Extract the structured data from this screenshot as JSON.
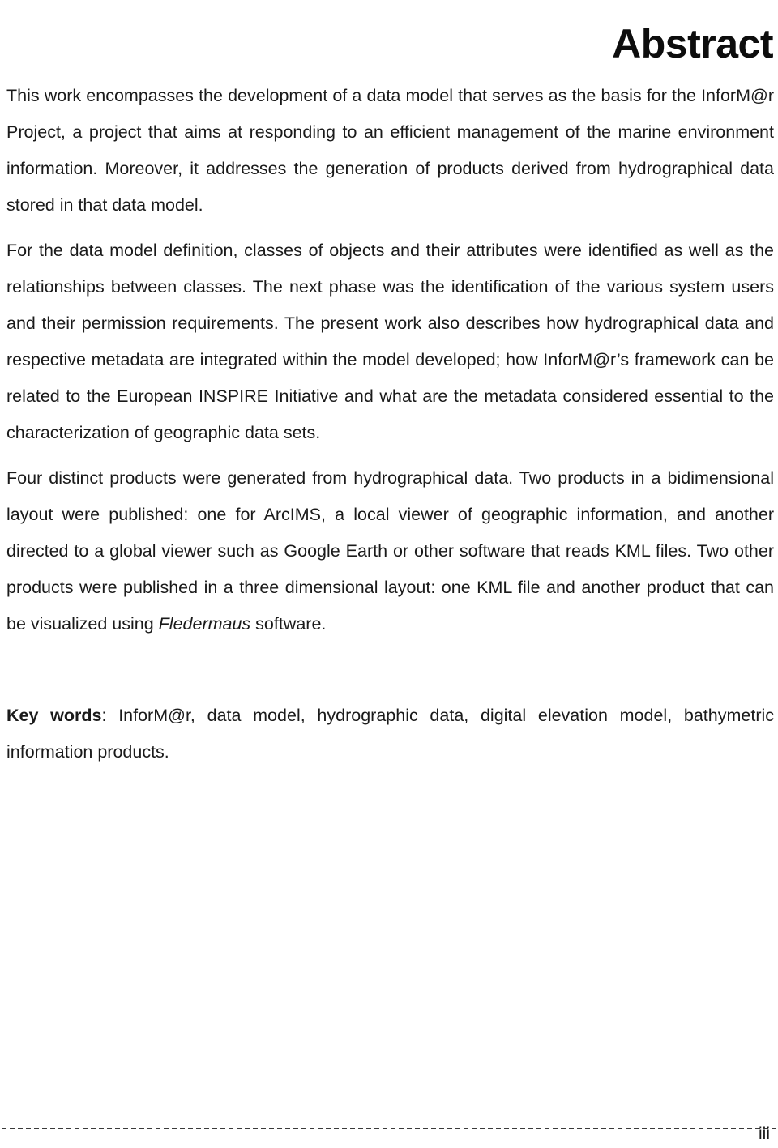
{
  "document": {
    "title": "Abstract",
    "paragraphs": [
      {
        "id": "para-1",
        "text": "This work encompasses the development of a data model that serves as the basis for the InforM@r Project, a project that aims at responding to an efficient management of the marine environment information. Moreover, it addresses the generation of products derived from hydrographical data stored in that data model."
      },
      {
        "id": "para-2",
        "text": "For the data model definition, classes of objects and their attributes were identified as well as the relationships between classes. The next phase was the identification of the various system users and their permission requirements. The present work also describes how hydrographical data and respective metadata are integrated within the model developed; how InforM@r’s framework can be related to the European INSPIRE Initiative and what are the metadata considered essential to the characterization of geographic data sets."
      }
    ],
    "paragraph_3": {
      "id": "para-3",
      "part_1": "Four distinct products were generated from hydrographical data. Two products in a bidimensional layout were published: one for ArcIMS, a local viewer of geographic information, and another directed to a global viewer such as Google Earth or other software that reads KML files. Two other products were published in a three dimensional layout: one KML file and another product that can be visualized using ",
      "software_name": "Fledermaus",
      "part_2": " software."
    },
    "keywords": {
      "label": "Key words",
      "separator": ": ",
      "text": "InforM@r, data model, hydrographic data, digital elevation model, bathymetric information products."
    },
    "footer": {
      "page_number": "iii"
    }
  }
}
